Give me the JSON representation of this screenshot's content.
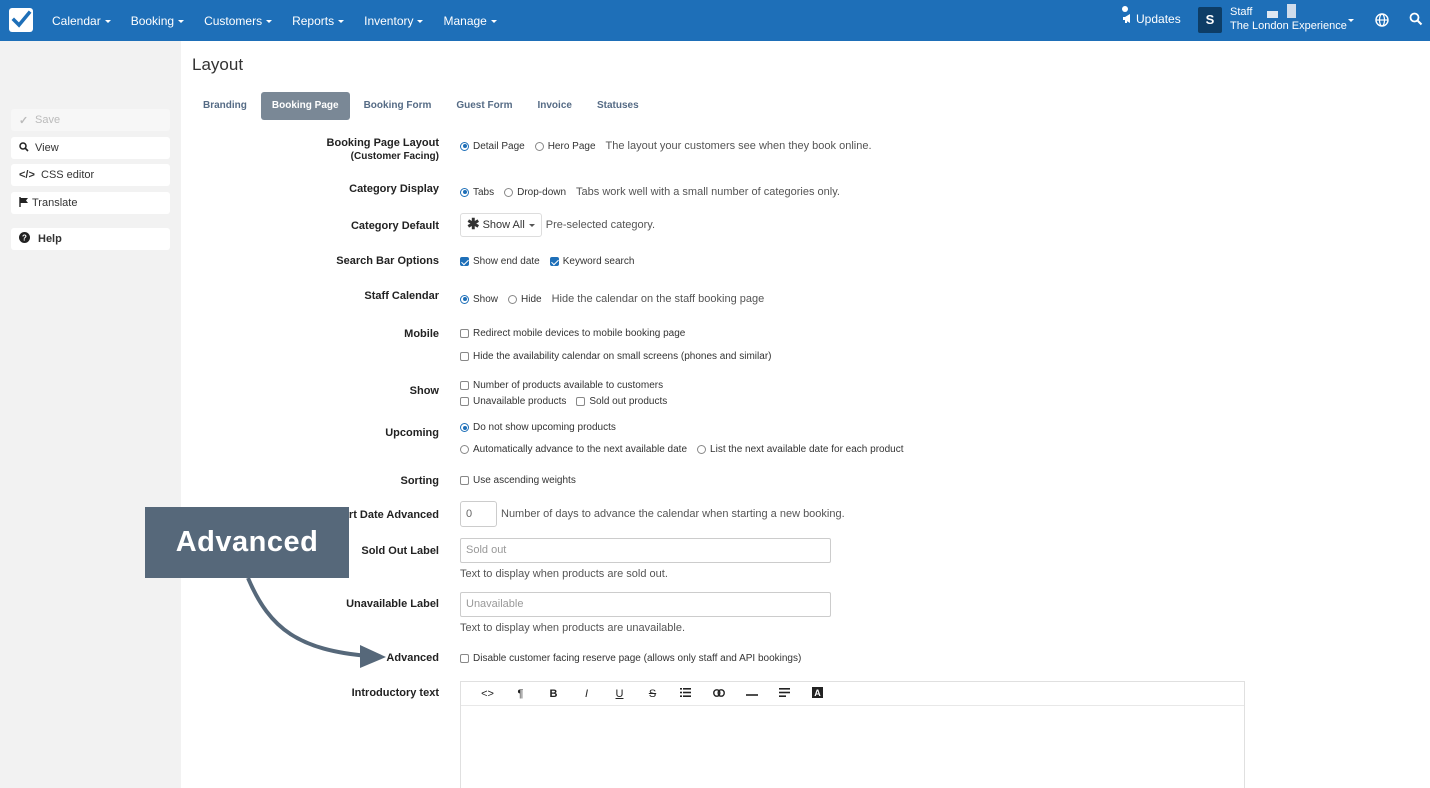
{
  "nav": {
    "items": [
      "Calendar",
      "Booking",
      "Customers",
      "Reports",
      "Inventory",
      "Manage"
    ],
    "updates": "Updates",
    "avatar_letter": "S",
    "staff_name": "Staff",
    "company": "The London Experience"
  },
  "sidebar": {
    "save": "Save",
    "view": "View",
    "css_editor": "CSS editor",
    "translate": "Translate",
    "help": "Help"
  },
  "page": {
    "title": "Layout",
    "tabs": [
      "Branding",
      "Booking Page",
      "Booking Form",
      "Guest Form",
      "Invoice",
      "Statuses"
    ],
    "active_tab": "Booking Page"
  },
  "form": {
    "layout": {
      "label": "Booking Page Layout",
      "sublabel": "(Customer Facing)",
      "opt1": "Detail Page",
      "opt2": "Hero Page",
      "selected": "Detail Page",
      "help": "The layout your customers see when they book online."
    },
    "category_display": {
      "label": "Category Display",
      "opt1": "Tabs",
      "opt2": "Drop-down",
      "selected": "Tabs",
      "help": "Tabs work well with a small number of categories only."
    },
    "category_default": {
      "label": "Category Default",
      "value": "Show All",
      "help": "Pre-selected category."
    },
    "search_bar": {
      "label": "Search Bar Options",
      "opt1": "Show end date",
      "opt2": "Keyword search"
    },
    "staff_calendar": {
      "label": "Staff Calendar",
      "opt1": "Show",
      "opt2": "Hide",
      "selected": "Show",
      "help": "Hide the calendar on the staff booking page"
    },
    "mobile": {
      "label": "Mobile",
      "opt1": "Redirect mobile devices to mobile booking page",
      "opt2": "Hide the availability calendar on small screens (phones and similar)"
    },
    "show": {
      "label": "Show",
      "opt1": "Number of products available to customers",
      "opt2": "Unavailable products",
      "opt3": "Sold out products"
    },
    "upcoming": {
      "label": "Upcoming",
      "opt1": "Do not show upcoming products",
      "opt2": "Automatically advance to the next available date",
      "opt3": "List the next available date for each product",
      "selected": "Do not show upcoming products"
    },
    "sorting": {
      "label": "Sorting",
      "opt1": "Use ascending weights"
    },
    "start_date": {
      "label": "Start Date Advanced",
      "value": "0",
      "help": "Number of days to advance the calendar when starting a new booking."
    },
    "sold_out": {
      "label": "Sold Out Label",
      "placeholder": "Sold out",
      "help": "Text to display when products are sold out."
    },
    "unavailable": {
      "label": "Unavailable Label",
      "placeholder": "Unavailable",
      "help": "Text to display when products are unavailable."
    },
    "advanced": {
      "label": "Advanced",
      "opt1": "Disable customer facing reserve page (allows only staff and API bookings)"
    },
    "intro": {
      "label": "Introductory text",
      "toolbar": [
        "<>",
        "¶",
        "B",
        "I",
        "U",
        "S",
        "list",
        "link",
        "hr",
        "align",
        "A"
      ]
    }
  },
  "callout": {
    "text": "Advanced"
  },
  "colors": {
    "nav_bg": "#1e6fb8",
    "tab_active": "#7a8896",
    "callout_bg": "#56687a"
  }
}
